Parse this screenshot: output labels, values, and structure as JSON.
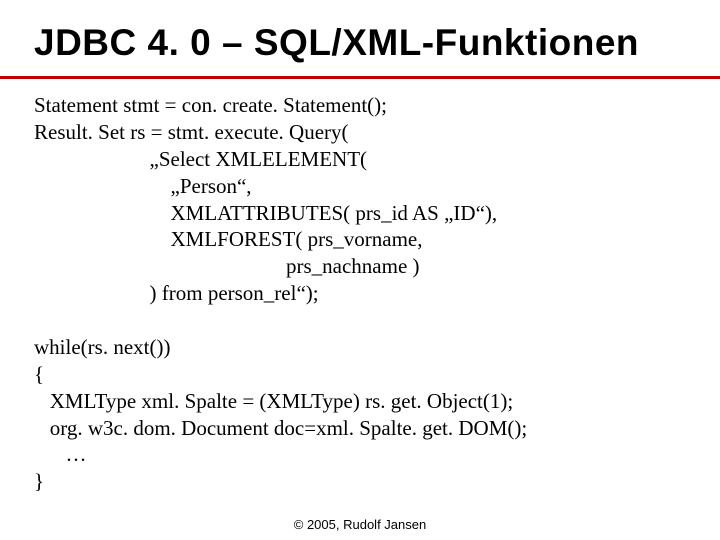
{
  "title": "JDBC 4. 0 – SQL/XML-Funktionen",
  "code": "Statement stmt = con. create. Statement();\nResult. Set rs = stmt. execute. Query(\n                      „Select XMLELEMENT(\n                          „Person“,\n                          XMLATTRIBUTES( prs_id AS „ID“),\n                          XMLFOREST( prs_vorname,\n                                                prs_nachname )\n                      ) from person_rel“);\n\nwhile(rs. next())\n{\n   XMLType xml. Spalte = (XMLType) rs. get. Object(1);\n   org. w3c. dom. Document doc=xml. Spalte. get. DOM();\n      …\n}",
  "footer": "© 2005, Rudolf Jansen"
}
